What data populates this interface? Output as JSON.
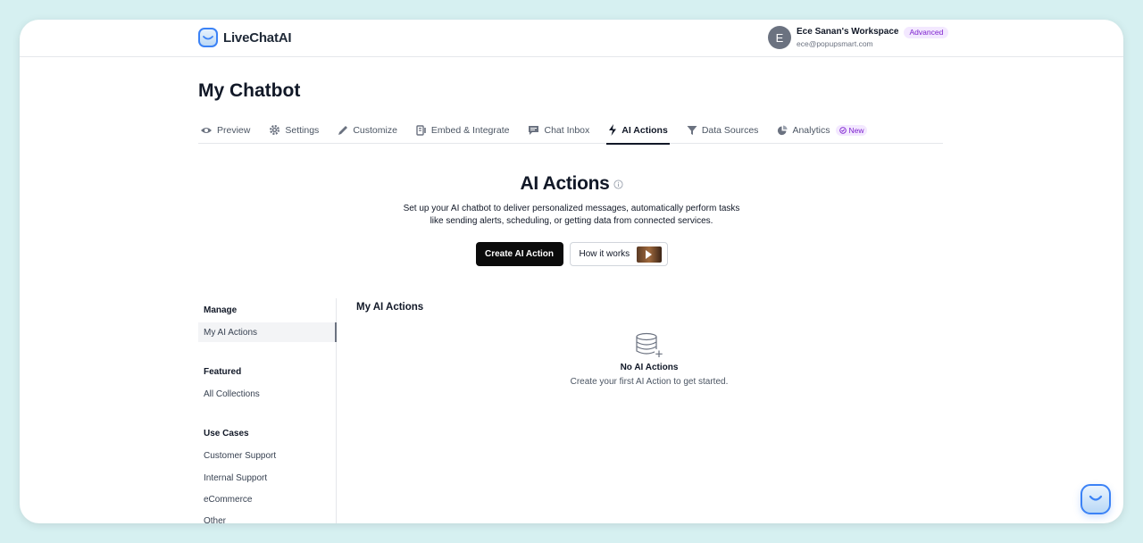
{
  "brand": {
    "name": "LiveChatAI"
  },
  "account": {
    "initial": "E",
    "workspace": "Ece Sanan's Workspace",
    "plan": "Advanced",
    "email": "ece@popupsmart.com"
  },
  "page": {
    "title": "My Chatbot"
  },
  "tabs": [
    {
      "label": "Preview",
      "icon": "eye-icon"
    },
    {
      "label": "Settings",
      "icon": "gear-icon"
    },
    {
      "label": "Customize",
      "icon": "pencil-icon"
    },
    {
      "label": "Embed & Integrate",
      "icon": "embed-icon"
    },
    {
      "label": "Chat Inbox",
      "icon": "chat-icon"
    },
    {
      "label": "AI Actions",
      "icon": "bolt-icon",
      "active": true
    },
    {
      "label": "Data Sources",
      "icon": "filter-icon"
    },
    {
      "label": "Analytics",
      "icon": "pie-chart-icon",
      "badge": "New"
    }
  ],
  "hero": {
    "title": "AI Actions",
    "description_line1": "Set up your AI chatbot to deliver personalized messages, automatically perform tasks",
    "description_line2": "like sending alerts, scheduling, or getting data from connected services.",
    "create_button": "Create AI Action",
    "how_button": "How it works"
  },
  "sidebar": {
    "manage_heading": "Manage",
    "manage_items": [
      "My AI Actions"
    ],
    "featured_heading": "Featured",
    "featured_items": [
      "All Collections"
    ],
    "use_cases_heading": "Use Cases",
    "use_case_items": [
      "Customer Support",
      "Internal Support",
      "eCommerce",
      "Other"
    ]
  },
  "main": {
    "section_title": "My AI Actions",
    "empty_title": "No AI Actions",
    "empty_subtitle": "Create your first AI Action to get started."
  },
  "colors": {
    "accent": "#3b82f6",
    "badge_purple": "#7e22ce",
    "badge_bg": "#f3e8ff",
    "primary_button": "#0b0b0b"
  }
}
